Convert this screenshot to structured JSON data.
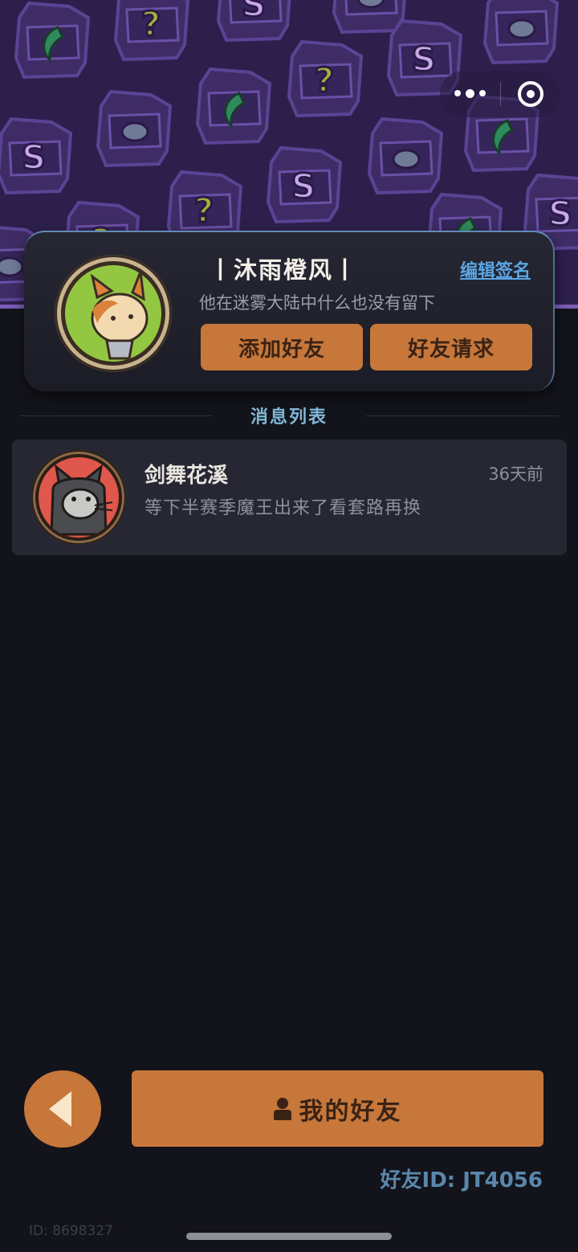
{
  "capsule": {
    "more_icon": "more-dots-icon",
    "close_icon": "target-circle-icon"
  },
  "profile": {
    "name": "丨沐雨橙风丨",
    "edit_sign_label": "编辑签名",
    "signature": "他在迷雾大陆中什么也没有留下",
    "add_friend_label": "添加好友",
    "friend_requests_label": "好友请求"
  },
  "messages": {
    "title": "消息列表",
    "items": [
      {
        "name": "剑舞花溪",
        "time": "36天前",
        "text": "等下半赛季魔王出来了看套路再换"
      }
    ]
  },
  "bottom": {
    "my_friends_label": "我的好友",
    "friend_id": "好友ID: JT4056",
    "user_id": "ID: 8698327"
  },
  "colors": {
    "background": "#13131b",
    "banner": "#2d1f4c",
    "accent_orange": "#c7773a",
    "link_blue": "#5aa5e3",
    "card": "#262733"
  }
}
